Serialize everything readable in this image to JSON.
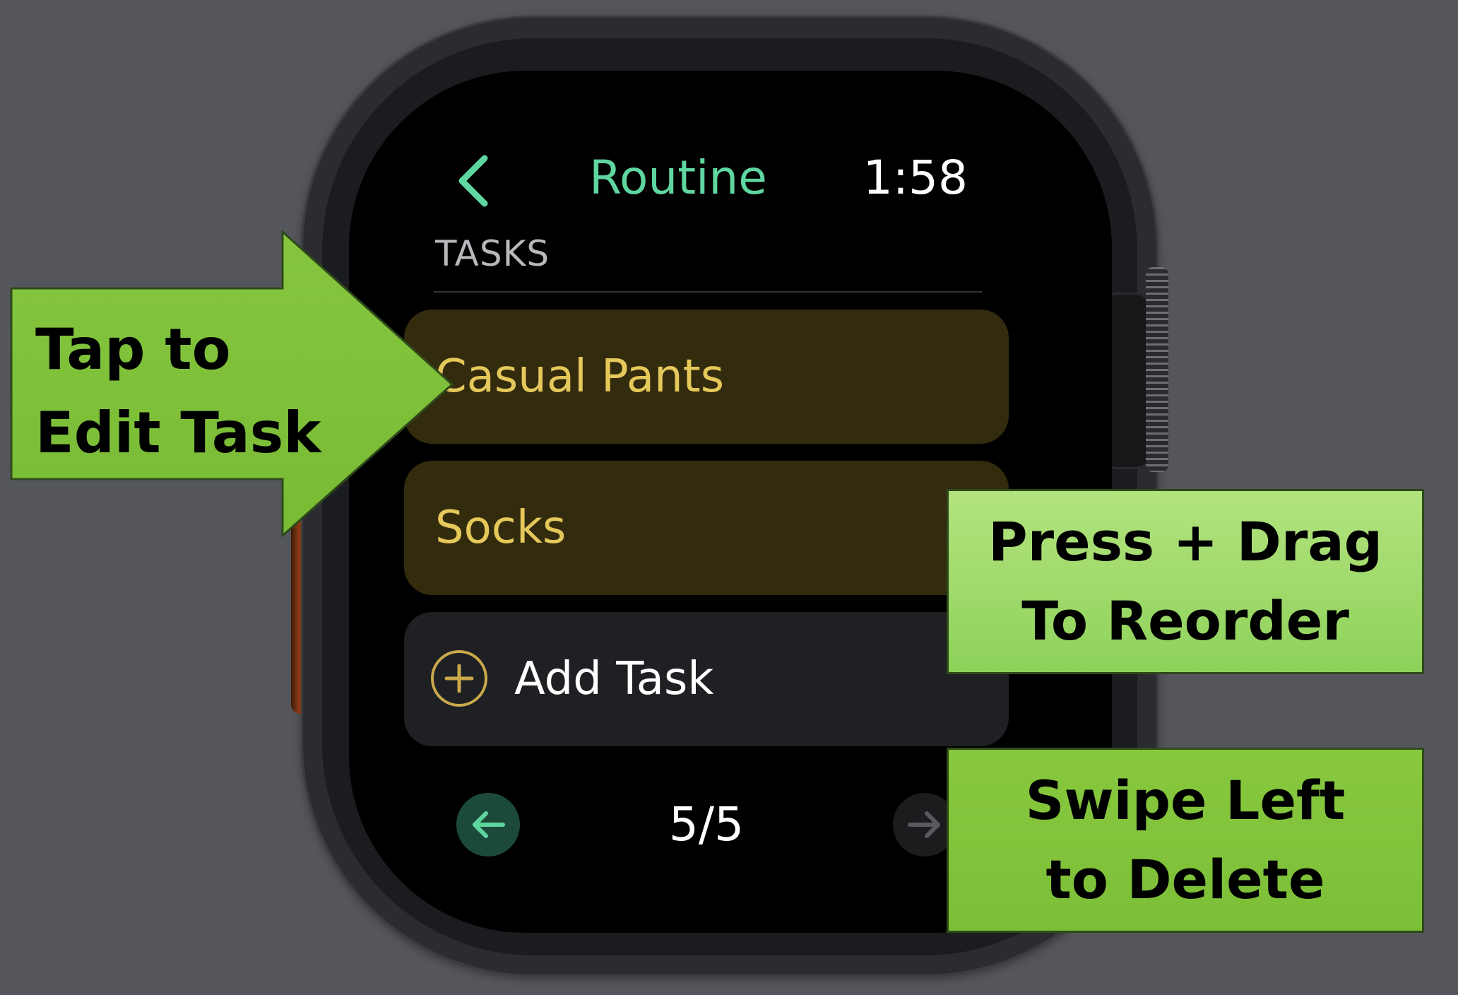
{
  "header": {
    "title": "Routine",
    "time": "1:58"
  },
  "list": {
    "section_title": "TASKS",
    "tasks": [
      {
        "label": "Casual Pants"
      },
      {
        "label": "Socks"
      }
    ],
    "add_task_label": "Add Task"
  },
  "pager": {
    "indicator": "5/5"
  },
  "annotations": {
    "tap": {
      "line1": "Tap to",
      "line2": "Edit Task"
    },
    "press": {
      "line1": "Press + Drag",
      "line2": "To Reorder"
    },
    "swipe": {
      "line1": "Swipe Left",
      "line2": "to Delete"
    }
  },
  "colors": {
    "background": "#55565c",
    "accent_green": "#5fd6a0",
    "task_fill": "#332b0e",
    "task_text": "#e5c85a",
    "callout_green": "#7dc13a"
  },
  "icons": {
    "back": "chevron-left-icon",
    "add": "plus-circle-icon",
    "prev": "arrow-left-icon",
    "next": "arrow-right-icon"
  }
}
